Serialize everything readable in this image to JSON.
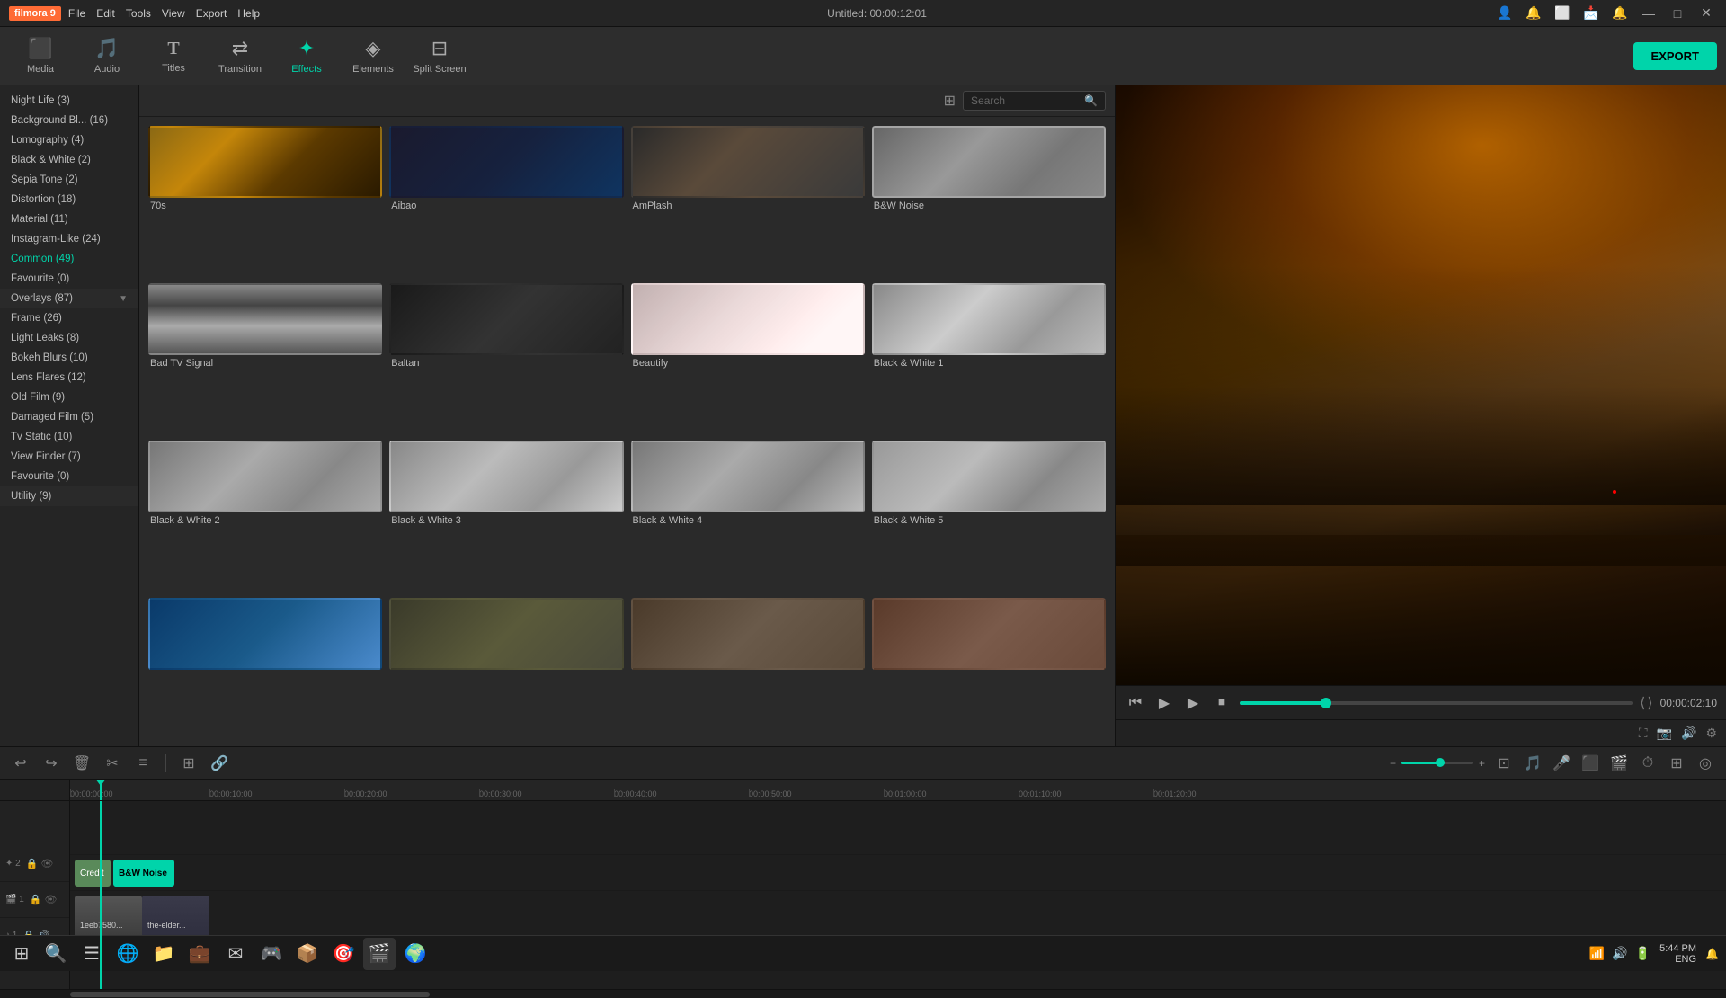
{
  "titleBar": {
    "appName": "filmora 9",
    "title": "Untitled: 00:00:12:01",
    "menuItems": [
      "File",
      "Edit",
      "Tools",
      "View",
      "Export",
      "Help"
    ],
    "buttons": [
      "minimize",
      "maximize",
      "close"
    ]
  },
  "toolbar": {
    "items": [
      {
        "id": "media",
        "label": "Media",
        "icon": "🖼"
      },
      {
        "id": "audio",
        "label": "Audio",
        "icon": "🎵"
      },
      {
        "id": "titles",
        "label": "Titles",
        "icon": "T"
      },
      {
        "id": "transition",
        "label": "Transition",
        "icon": "↔"
      },
      {
        "id": "effects",
        "label": "Effects",
        "icon": "✦"
      },
      {
        "id": "elements",
        "label": "Elements",
        "icon": "◈"
      },
      {
        "id": "splitscreen",
        "label": "Split Screen",
        "icon": "⊟"
      }
    ],
    "exportLabel": "EXPORT",
    "activeItem": "effects"
  },
  "sidebar": {
    "items": [
      {
        "label": "Night Life (3)"
      },
      {
        "label": "Background Bl... (16)"
      },
      {
        "label": "Lomography (4)"
      },
      {
        "label": "Black & White (2)"
      },
      {
        "label": "Sepia Tone (2)"
      },
      {
        "label": "Distortion (18)"
      },
      {
        "label": "Material (11)"
      },
      {
        "label": "Instagram-Like (24)"
      },
      {
        "label": "Common (49)",
        "active": true
      },
      {
        "label": "Favourite (0)"
      }
    ],
    "sections": [
      {
        "label": "Overlays (87)",
        "expanded": true
      },
      {
        "label": "Frame (26)"
      },
      {
        "label": "Light Leaks (8)"
      },
      {
        "label": "Bokeh Blurs (10)"
      },
      {
        "label": "Lens Flares (12)"
      },
      {
        "label": "Old Film (9)"
      },
      {
        "label": "Damaged Film (5)"
      },
      {
        "label": "Tv Static (10)"
      },
      {
        "label": "View Finder (7)"
      },
      {
        "label": "Favourite (0)"
      }
    ],
    "utility": {
      "label": "Utility (9)"
    }
  },
  "effectsPanel": {
    "searchPlaceholder": "Search",
    "effects": [
      {
        "id": "70s",
        "label": "70s",
        "thumbClass": "thumb-70s"
      },
      {
        "id": "aibao",
        "label": "Aibao",
        "thumbClass": "thumb-aibao"
      },
      {
        "id": "amplash",
        "label": "AmPlash",
        "thumbClass": "thumb-amplash"
      },
      {
        "id": "bwnoise",
        "label": "B&W Noise",
        "thumbClass": "thumb-bwnoise",
        "selected": true
      },
      {
        "id": "badtv",
        "label": "Bad TV Signal",
        "thumbClass": "thumb-badtv"
      },
      {
        "id": "baltan",
        "label": "Baltan",
        "thumbClass": "thumb-baltan"
      },
      {
        "id": "beautify",
        "label": "Beautify",
        "thumbClass": "thumb-beautify"
      },
      {
        "id": "bw1",
        "label": "Black & White 1",
        "thumbClass": "thumb-bw1"
      },
      {
        "id": "bw2",
        "label": "Black & White 2",
        "thumbClass": "thumb-bw2"
      },
      {
        "id": "bw3",
        "label": "Black & White 3",
        "thumbClass": "thumb-bw3"
      },
      {
        "id": "bw4",
        "label": "Black & White 4",
        "thumbClass": "thumb-bw4"
      },
      {
        "id": "bw5",
        "label": "Black & White 5",
        "thumbClass": "thumb-bw5"
      },
      {
        "id": "row4a",
        "label": "",
        "thumbClass": "thumb-row4a"
      },
      {
        "id": "row4b",
        "label": "",
        "thumbClass": "thumb-row4b"
      },
      {
        "id": "row4c",
        "label": "",
        "thumbClass": "thumb-row4c"
      },
      {
        "id": "row4d",
        "label": "",
        "thumbClass": "thumb-row4d"
      }
    ]
  },
  "videoControls": {
    "timeDisplay": "00:00:02:10",
    "progressPercent": 22
  },
  "timeline": {
    "rulerMarks": [
      "00:00:00:00",
      "00:00:10:00",
      "00:00:20:00",
      "00:00:30:00",
      "00:00:40:00",
      "00:00:50:00",
      "00:01:00:00",
      "00:01:10:00",
      "00:01:20:00"
    ],
    "tracks": [
      {
        "id": "track3",
        "num": "2",
        "clips": [
          {
            "label": "Credit",
            "class": "clip-credit"
          },
          {
            "label": "B&W Noise",
            "class": "clip-bwnoise"
          }
        ]
      },
      {
        "id": "track1",
        "num": "1",
        "clips": [
          {
            "label": "1eeb75307b...",
            "class": "clip-video1"
          },
          {
            "label": "the-elder-s...",
            "class": "clip-video2"
          }
        ]
      }
    ],
    "audioTrack": {
      "num": "1"
    }
  },
  "taskbar": {
    "time": "5:44 PM",
    "lang": "ENG",
    "apps": [
      "⊞",
      "⊙",
      "☰",
      "🌐",
      "📁",
      "💻",
      "🛒",
      "📧",
      "🎮",
      "📦",
      "🎯",
      "🌍"
    ]
  }
}
